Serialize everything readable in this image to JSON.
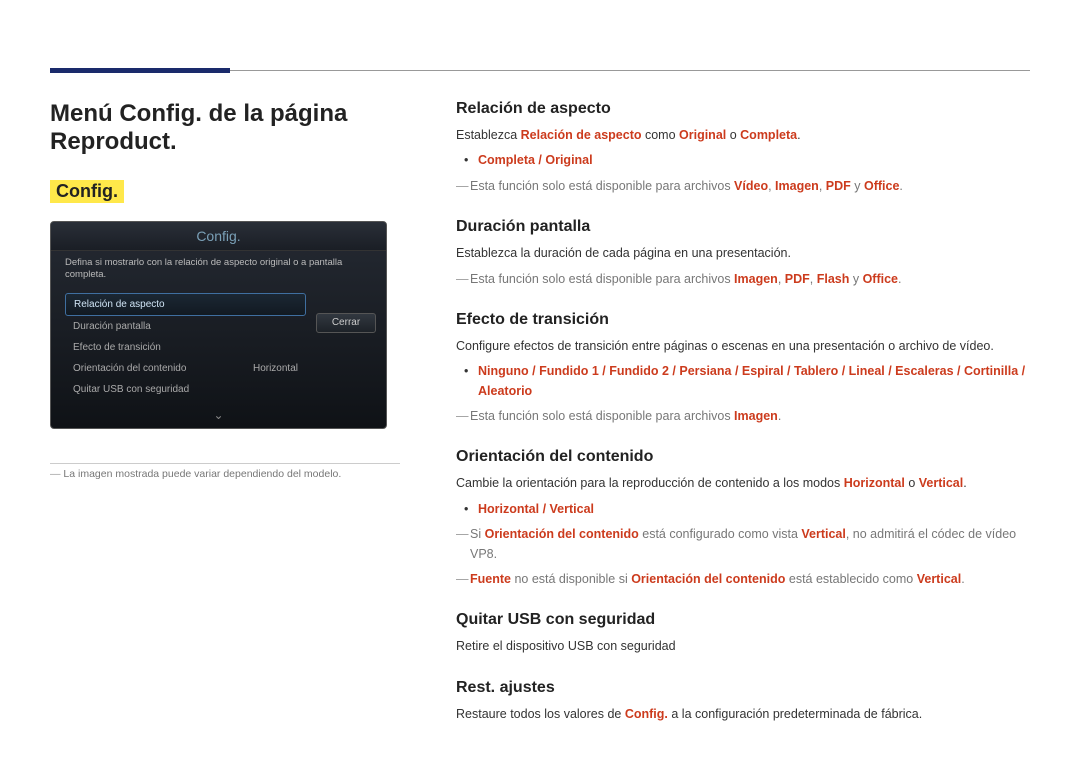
{
  "page_title": "Menú Config. de la página Reproduct.",
  "sub_heading": "Config.",
  "mock": {
    "title": "Config.",
    "help": "Defina si mostrarlo con la relación de aspecto original o a pantalla completa.",
    "items": [
      {
        "label": "Relación de aspecto",
        "value": ""
      },
      {
        "label": "Duración pantalla",
        "value": ""
      },
      {
        "label": "Efecto de transición",
        "value": ""
      },
      {
        "label": "Orientación del contenido",
        "value": "Horizontal"
      },
      {
        "label": "Quitar USB con seguridad",
        "value": ""
      }
    ],
    "close_label": "Cerrar"
  },
  "under_mock_note": "La imagen mostrada puede variar dependiendo del modelo.",
  "sections": {
    "aspect": {
      "heading": "Relación de aspecto",
      "body_parts": {
        "p1": "Establezca ",
        "k1": "Relación de aspecto",
        "p2": " como ",
        "k2": "Original",
        "p3": " o ",
        "k3": "Completa",
        "p4": "."
      },
      "options": "Completa / Original",
      "note_parts": {
        "p1": "Esta función solo está disponible para archivos ",
        "k1": "Vídeo",
        "s1": ", ",
        "k2": "Imagen",
        "s2": ", ",
        "k3": "PDF",
        "s3": " y ",
        "k4": "Office",
        "p2": "."
      }
    },
    "duration": {
      "heading": "Duración pantalla",
      "body": "Establezca la duración de cada página en una presentación.",
      "note_parts": {
        "p1": "Esta función solo está disponible para archivos ",
        "k1": "Imagen",
        "s1": ", ",
        "k2": "PDF",
        "s2": ", ",
        "k3": "Flash",
        "s3": " y ",
        "k4": "Office",
        "p2": "."
      }
    },
    "transition": {
      "heading": "Efecto de transición",
      "body": "Configure efectos de transición entre páginas o escenas en una presentación o archivo de vídeo.",
      "options": "Ninguno / Fundido 1 / Fundido 2 / Persiana / Espiral / Tablero / Lineal / Escaleras / Cortinilla / Aleatorio",
      "note_parts": {
        "p1": "Esta función solo está disponible para archivos ",
        "k1": "Imagen",
        "p2": "."
      }
    },
    "orientation": {
      "heading": "Orientación del contenido",
      "body_parts": {
        "p1": "Cambie la orientación para la reproducción de contenido a los modos ",
        "k1": "Horizontal",
        "p2": " o ",
        "k2": "Vertical",
        "p3": "."
      },
      "options": "Horizontal / Vertical",
      "note1_parts": {
        "p1": "Si ",
        "k1": "Orientación del contenido",
        "p2": " está configurado como vista ",
        "k2": "Vertical",
        "p3": ", no admitirá el códec de vídeo VP8."
      },
      "note2_parts": {
        "k1": "Fuente",
        "p1": " no está disponible si ",
        "k2": "Orientación del contenido",
        "p2": " está establecido como ",
        "k3": "Vertical",
        "p3": "."
      }
    },
    "usb": {
      "heading": "Quitar USB con seguridad",
      "body": "Retire el dispositivo USB con seguridad"
    },
    "reset": {
      "heading": "Rest. ajustes",
      "body_parts": {
        "p1": "Restaure todos los valores de ",
        "k1": "Config.",
        "p2": " a la configuración predeterminada de fábrica."
      }
    }
  }
}
